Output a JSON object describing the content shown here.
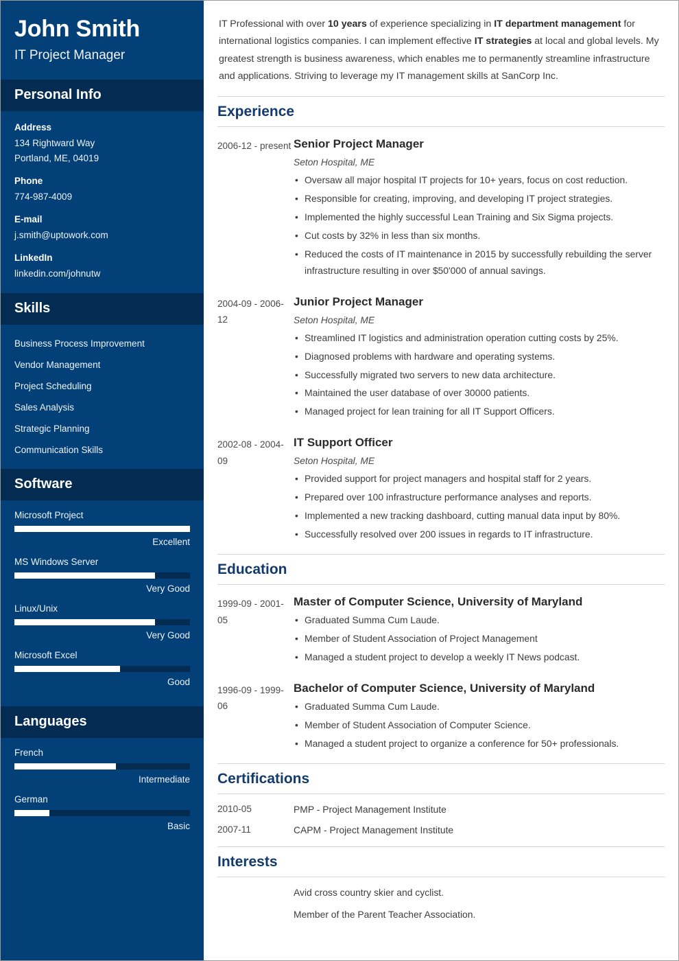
{
  "sidebar": {
    "name": "John Smith",
    "job_title": "IT Project Manager",
    "personal_info": {
      "band_title": "Personal Info",
      "groups": [
        {
          "label": "Address",
          "line1": "134 Rightward Way",
          "line2": "Portland, ME, 04019"
        },
        {
          "label": "Phone",
          "line1": "774-987-4009"
        },
        {
          "label": "E-mail",
          "line1": "j.smith@uptowork.com"
        },
        {
          "label": "LinkedIn",
          "line1": "linkedin.com/johnutw"
        }
      ]
    },
    "skills": {
      "band_title": "Skills",
      "items": [
        "Business Process Improvement",
        "Vendor Management",
        "Project Scheduling",
        "Sales Analysis",
        "Strategic Planning",
        "Communication Skills"
      ]
    },
    "software": {
      "band_title": "Software",
      "items": [
        {
          "name": "Microsoft Project",
          "level": "Excellent",
          "percent": 100
        },
        {
          "name": "MS Windows Server",
          "level": "Very Good",
          "percent": 80
        },
        {
          "name": "Linux/Unix",
          "level": "Very Good",
          "percent": 80
        },
        {
          "name": "Microsoft Excel",
          "level": "Good",
          "percent": 60
        }
      ]
    },
    "languages": {
      "band_title": "Languages",
      "items": [
        {
          "name": "French",
          "level": "Intermediate",
          "percent": 58
        },
        {
          "name": "German",
          "level": "Basic",
          "percent": 20
        }
      ]
    }
  },
  "main": {
    "summary": {
      "part1": "IT Professional with over ",
      "bold1": "10 years",
      "part2": " of experience specializing in ",
      "bold2": "IT department management",
      "part3": " for international logistics companies. I can implement effective ",
      "bold3": "IT strategies",
      "part4": " at local and global levels. My greatest strength is business awareness, which enables me to permanently streamline infrastructure and applications. Striving to leverage my IT management skills at SanCorp Inc."
    },
    "experience": {
      "title": "Experience",
      "entries": [
        {
          "date": "2006-12 - present",
          "title": "Senior Project Manager",
          "subtitle": "Seton Hospital, ME",
          "bullets": [
            "Oversaw all major hospital IT projects for 10+ years, focus on cost reduction.",
            "Responsible for creating, improving, and developing IT project strategies.",
            "Implemented the highly successful Lean Training and Six Sigma projects.",
            "Cut costs by 32% in less than six months.",
            "Reduced the costs of IT maintenance in 2015 by successfully rebuilding the server infrastructure resulting in over $50'000 of annual savings."
          ]
        },
        {
          "date": "2004-09 - 2006-12",
          "title": "Junior Project Manager",
          "subtitle": "Seton Hospital, ME",
          "bullets": [
            "Streamlined IT logistics and administration operation cutting costs by 25%.",
            "Diagnosed problems with hardware and operating systems.",
            "Successfully migrated two servers to new data architecture.",
            "Maintained the user database of over 30000 patients.",
            "Managed project for lean training for all IT Support Officers."
          ]
        },
        {
          "date": "2002-08 - 2004-09",
          "title": "IT Support Officer",
          "subtitle": "Seton Hospital, ME",
          "bullets": [
            "Provided support for project managers and hospital staff for 2 years.",
            "Prepared over 100 infrastructure performance analyses and reports.",
            "Implemented a new tracking dashboard, cutting manual data input by 80%.",
            "Successfully resolved over 200 issues in regards to IT infrastructure."
          ]
        }
      ]
    },
    "education": {
      "title": "Education",
      "entries": [
        {
          "date": "1999-09 - 2001-05",
          "title": "Master of Computer Science, University of Maryland",
          "bullets": [
            "Graduated Summa Cum Laude.",
            "Member of Student Association of Project Management",
            "Managed a student project to develop a weekly IT News podcast."
          ]
        },
        {
          "date": "1996-09 - 1999-06",
          "title": "Bachelor of Computer Science, University of Maryland",
          "bullets": [
            "Graduated Summa Cum Laude.",
            "Member of Student Association of Computer Science.",
            "Managed a student project to organize a conference for 50+ professionals."
          ]
        }
      ]
    },
    "certifications": {
      "title": "Certifications",
      "rows": [
        {
          "date": "2010-05",
          "text": "PMP - Project Management Institute"
        },
        {
          "date": "2007-11",
          "text": "CAPM - Project Management Institute"
        }
      ]
    },
    "interests": {
      "title": "Interests",
      "items": [
        "Avid cross country skier and cyclist.",
        "Member of the Parent Teacher Association."
      ]
    }
  },
  "colors": {
    "sidebar_bg": "#024077",
    "band_bg": "#042B52",
    "heading": "#123A6B",
    "bar_fill": "#ffffff",
    "bar_track": "#042B52"
  }
}
